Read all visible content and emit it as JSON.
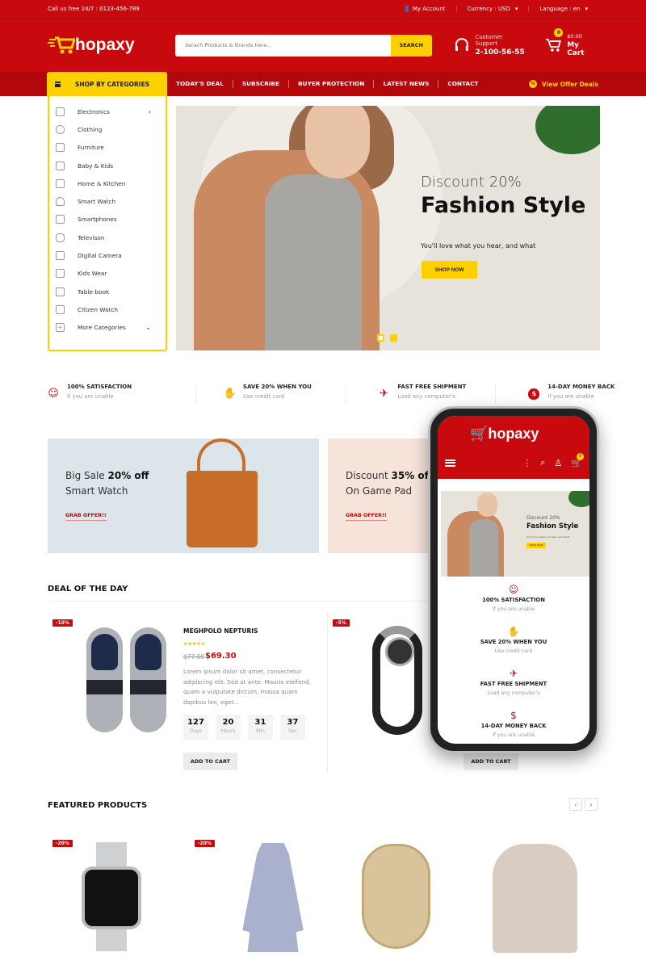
{
  "topbar": {
    "call_text": "Call us free 24/7 : 0123-456-789",
    "account_label": "My Account",
    "currency_label": "Currency : USD",
    "language_label": "Language : en"
  },
  "header": {
    "logo_text": "hopaxy",
    "search": {
      "placeholder": "Serach Products & Brands here...",
      "value": "",
      "button_label": "SEARCH"
    },
    "support": {
      "label": "Customer Support",
      "phone": "2-100-56-55"
    },
    "cart": {
      "count": "0",
      "total": "$0.00",
      "label": "My Cart"
    }
  },
  "nav": {
    "categories_label": "SHOP BY CATEGORIES",
    "links": [
      "TODAY'S DEAL",
      "SUBSCRIBE",
      "BUYER PROTECTION",
      "LATEST NEWS",
      "CONTACT"
    ],
    "offer_label": "View Offer Deals"
  },
  "sidebar": {
    "items": [
      {
        "label": "Electronics",
        "icon": "electronics-icon",
        "has_submenu": true
      },
      {
        "label": "Clothing",
        "icon": "clothing-icon"
      },
      {
        "label": "Furniture",
        "icon": "furniture-icon"
      },
      {
        "label": "Baby & Kids",
        "icon": "baby-icon"
      },
      {
        "label": "Home & Kitchen",
        "icon": "home-icon"
      },
      {
        "label": "Smart Watch",
        "icon": "lamp-icon"
      },
      {
        "label": "Smartphones",
        "icon": "phone-icon"
      },
      {
        "label": "Televison",
        "icon": "tv-icon"
      },
      {
        "label": "Digital Camera",
        "icon": "shirt-icon"
      },
      {
        "label": "Kids Wear",
        "icon": "monitor-icon"
      },
      {
        "label": "Table-book",
        "icon": "table-icon"
      },
      {
        "label": "Citizen Watch",
        "icon": "sofa-icon"
      }
    ],
    "more_label": "More Categories"
  },
  "hero": {
    "subtitle": "Discount 20%",
    "title": "Fashion Style",
    "text": "You'll love what you hear, and what",
    "button_label": "SHOP NOW",
    "slides": 2,
    "active_slide": 1
  },
  "features": [
    {
      "title": "100% SATISFACTION",
      "text": "If you are unable",
      "icon": "smiley-icon",
      "glyph": "☺"
    },
    {
      "title": "SAVE 20% WHEN YOU",
      "text": "Use credit card",
      "icon": "thumbs-up-icon",
      "glyph": "👍"
    },
    {
      "title": "FAST FREE SHIPMENT",
      "text": "Load any computer's",
      "icon": "plane-icon",
      "glyph": "✈"
    },
    {
      "title": "14-DAY MONEY BACK",
      "text": "If you are unable",
      "icon": "money-bag-icon",
      "glyph": "$"
    }
  ],
  "banners": [
    {
      "prefix": "Big Sale ",
      "bold": "20% off",
      "line2": "Smart Watch",
      "link": "GRAB OFFER!!"
    },
    {
      "prefix": "Discount ",
      "bold": "35% off",
      "line2": "On Game Pad",
      "link": "GRAB OFFER!!"
    }
  ],
  "deal_section": {
    "title": "DEAL OF THE DAY",
    "products": [
      {
        "discount": "-10%",
        "name": "MEGHPOLO NEPTURIS",
        "rating": 5,
        "stars": "★★★★★",
        "old_price": "$77.00",
        "price": "$69.30",
        "description": "Lorem ipsum dolor sit amet, consectetur adipiscing elit. Sed at ante. Mauris eleifend, quam a vulputate dictum, massa quam dapibus leo, eget...",
        "countdown": [
          {
            "value": "127",
            "unit": "Days"
          },
          {
            "value": "20",
            "unit": "Hours"
          },
          {
            "value": "31",
            "unit": "Min"
          },
          {
            "value": "37",
            "unit": "Sec"
          }
        ],
        "button_label": "ADD TO CART"
      },
      {
        "discount": "-5%",
        "button_label": "ADD TO CART"
      }
    ]
  },
  "mobile": {
    "logo_text": "hopaxy",
    "cart_count": "0",
    "hero": {
      "subtitle": "Discount 20%",
      "title": "Fashion Style",
      "text": "You'll love what you hear, and what",
      "button_label": "SHOP NOW"
    }
  },
  "featured": {
    "title": "FEATURED PRODUCTS",
    "prev_label": "‹",
    "next_label": "›",
    "products": [
      {
        "discount": "-20%",
        "type": "watch"
      },
      {
        "discount": "-20%",
        "type": "dress"
      },
      {
        "discount": "",
        "type": "lantern"
      },
      {
        "discount": "",
        "type": "hoodie"
      }
    ]
  },
  "colors": {
    "brand_red": "#c80a0e",
    "accent_yellow": "#ffd000",
    "nav_red": "#b2080b"
  }
}
